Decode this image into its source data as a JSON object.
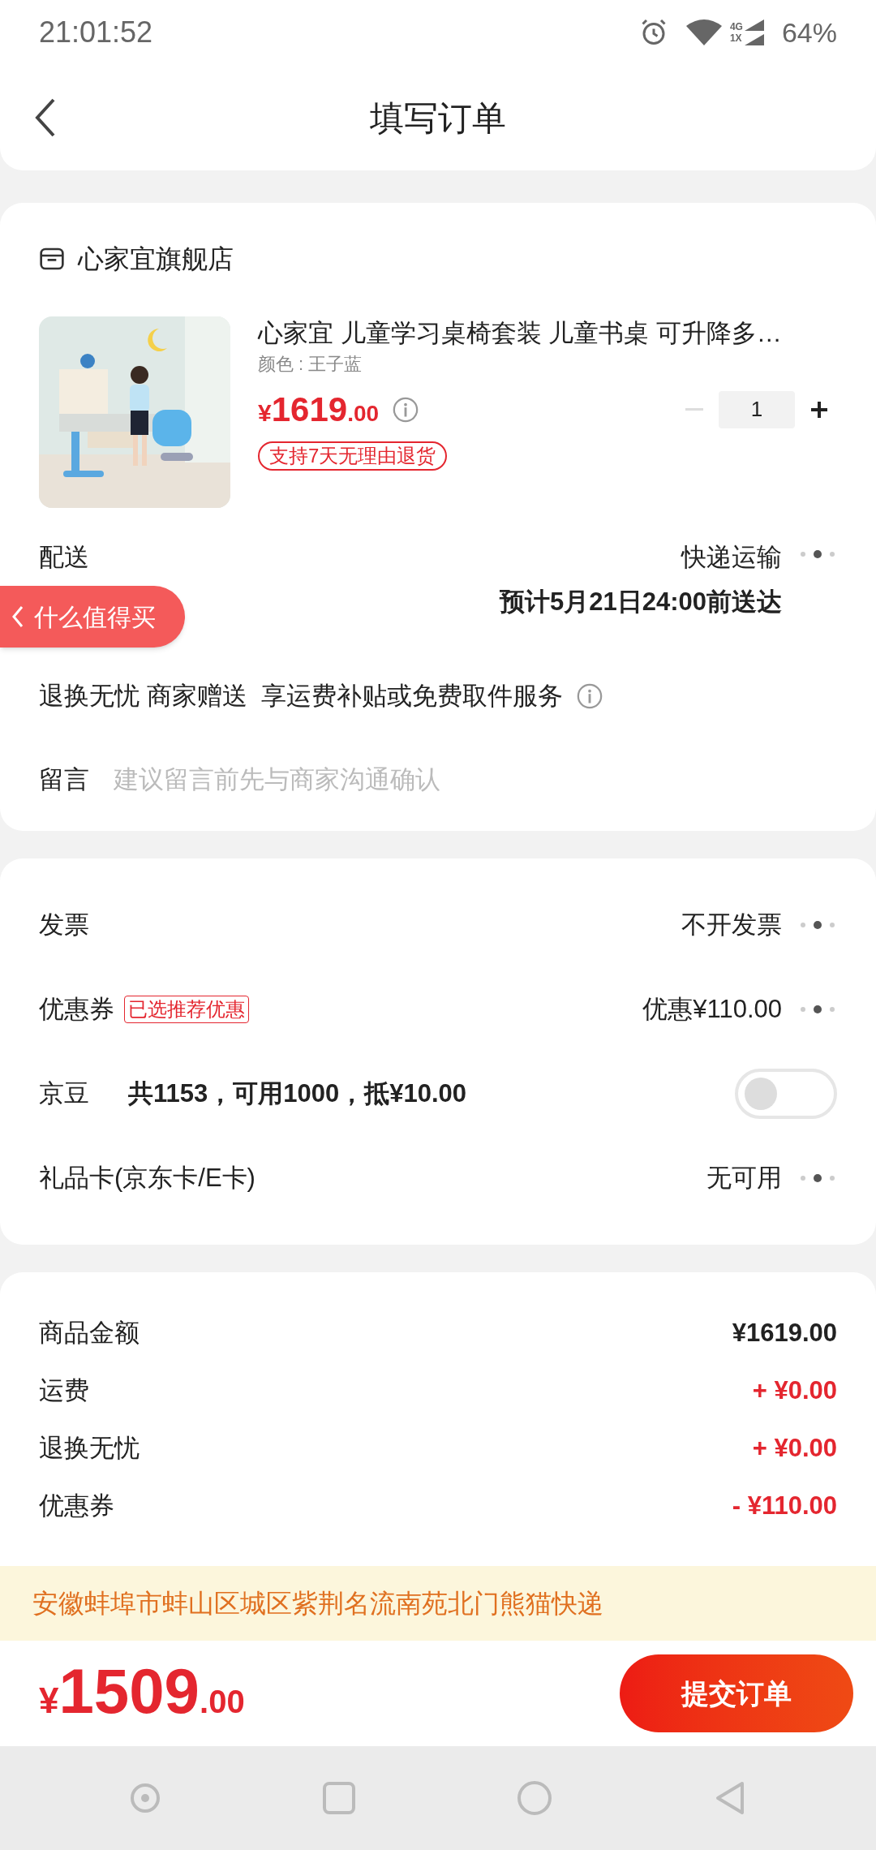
{
  "status_bar": {
    "time": "21:01:52",
    "network_labels": [
      "4G",
      "1X"
    ],
    "battery": "64%"
  },
  "header": {
    "title": "填写订单"
  },
  "store": {
    "name": "心家宜旗舰店"
  },
  "product": {
    "title": "心家宜 儿童学习桌椅套装 儿童书桌 可升降多…",
    "variant": "颜色 : 王子蓝",
    "price": {
      "currency": "¥",
      "integer": "1619",
      "decimal": ".00"
    },
    "tag": "支持7天无理由退货",
    "quantity": "1",
    "decrease_disabled": true
  },
  "delivery": {
    "label": "配送",
    "method": "快递运输",
    "eta": "预计5月21日24:00前送达"
  },
  "service": {
    "text": "退换无忧 商家赠送  享运费补贴或免费取件服务"
  },
  "note": {
    "label": "留言",
    "placeholder": "建议留言前先与商家沟通确认"
  },
  "floating_button": {
    "label": "什么值得买"
  },
  "options": [
    {
      "kind": "link",
      "label": "发票",
      "value": "不开发票"
    },
    {
      "kind": "link",
      "label": "优惠券",
      "badge": "已选推荐优惠",
      "value": "优惠¥110.00"
    },
    {
      "kind": "toggle",
      "label": "京豆",
      "detail": "共1153，可用1000，抵¥10.00",
      "on": false
    },
    {
      "kind": "link",
      "label": "礼品卡(京东卡/E卡)",
      "value": "无可用"
    }
  ],
  "summary": [
    {
      "kind": "base",
      "label": "商品金额",
      "value": "¥1619.00"
    },
    {
      "kind": "adjustment",
      "label": "运费",
      "value": "+ ¥0.00"
    },
    {
      "kind": "adjustment",
      "label": "退换无忧",
      "value": "+ ¥0.00"
    },
    {
      "kind": "adjustment",
      "label": "优惠券",
      "value": "- ¥110.00"
    }
  ],
  "address_bar": {
    "text": "安徽蚌埠市蚌山区城区紫荆名流南苑北门熊猫快递"
  },
  "footer": {
    "total": {
      "currency": "¥",
      "integer": "1509",
      "decimal": ".00"
    },
    "submit": "提交订单"
  }
}
